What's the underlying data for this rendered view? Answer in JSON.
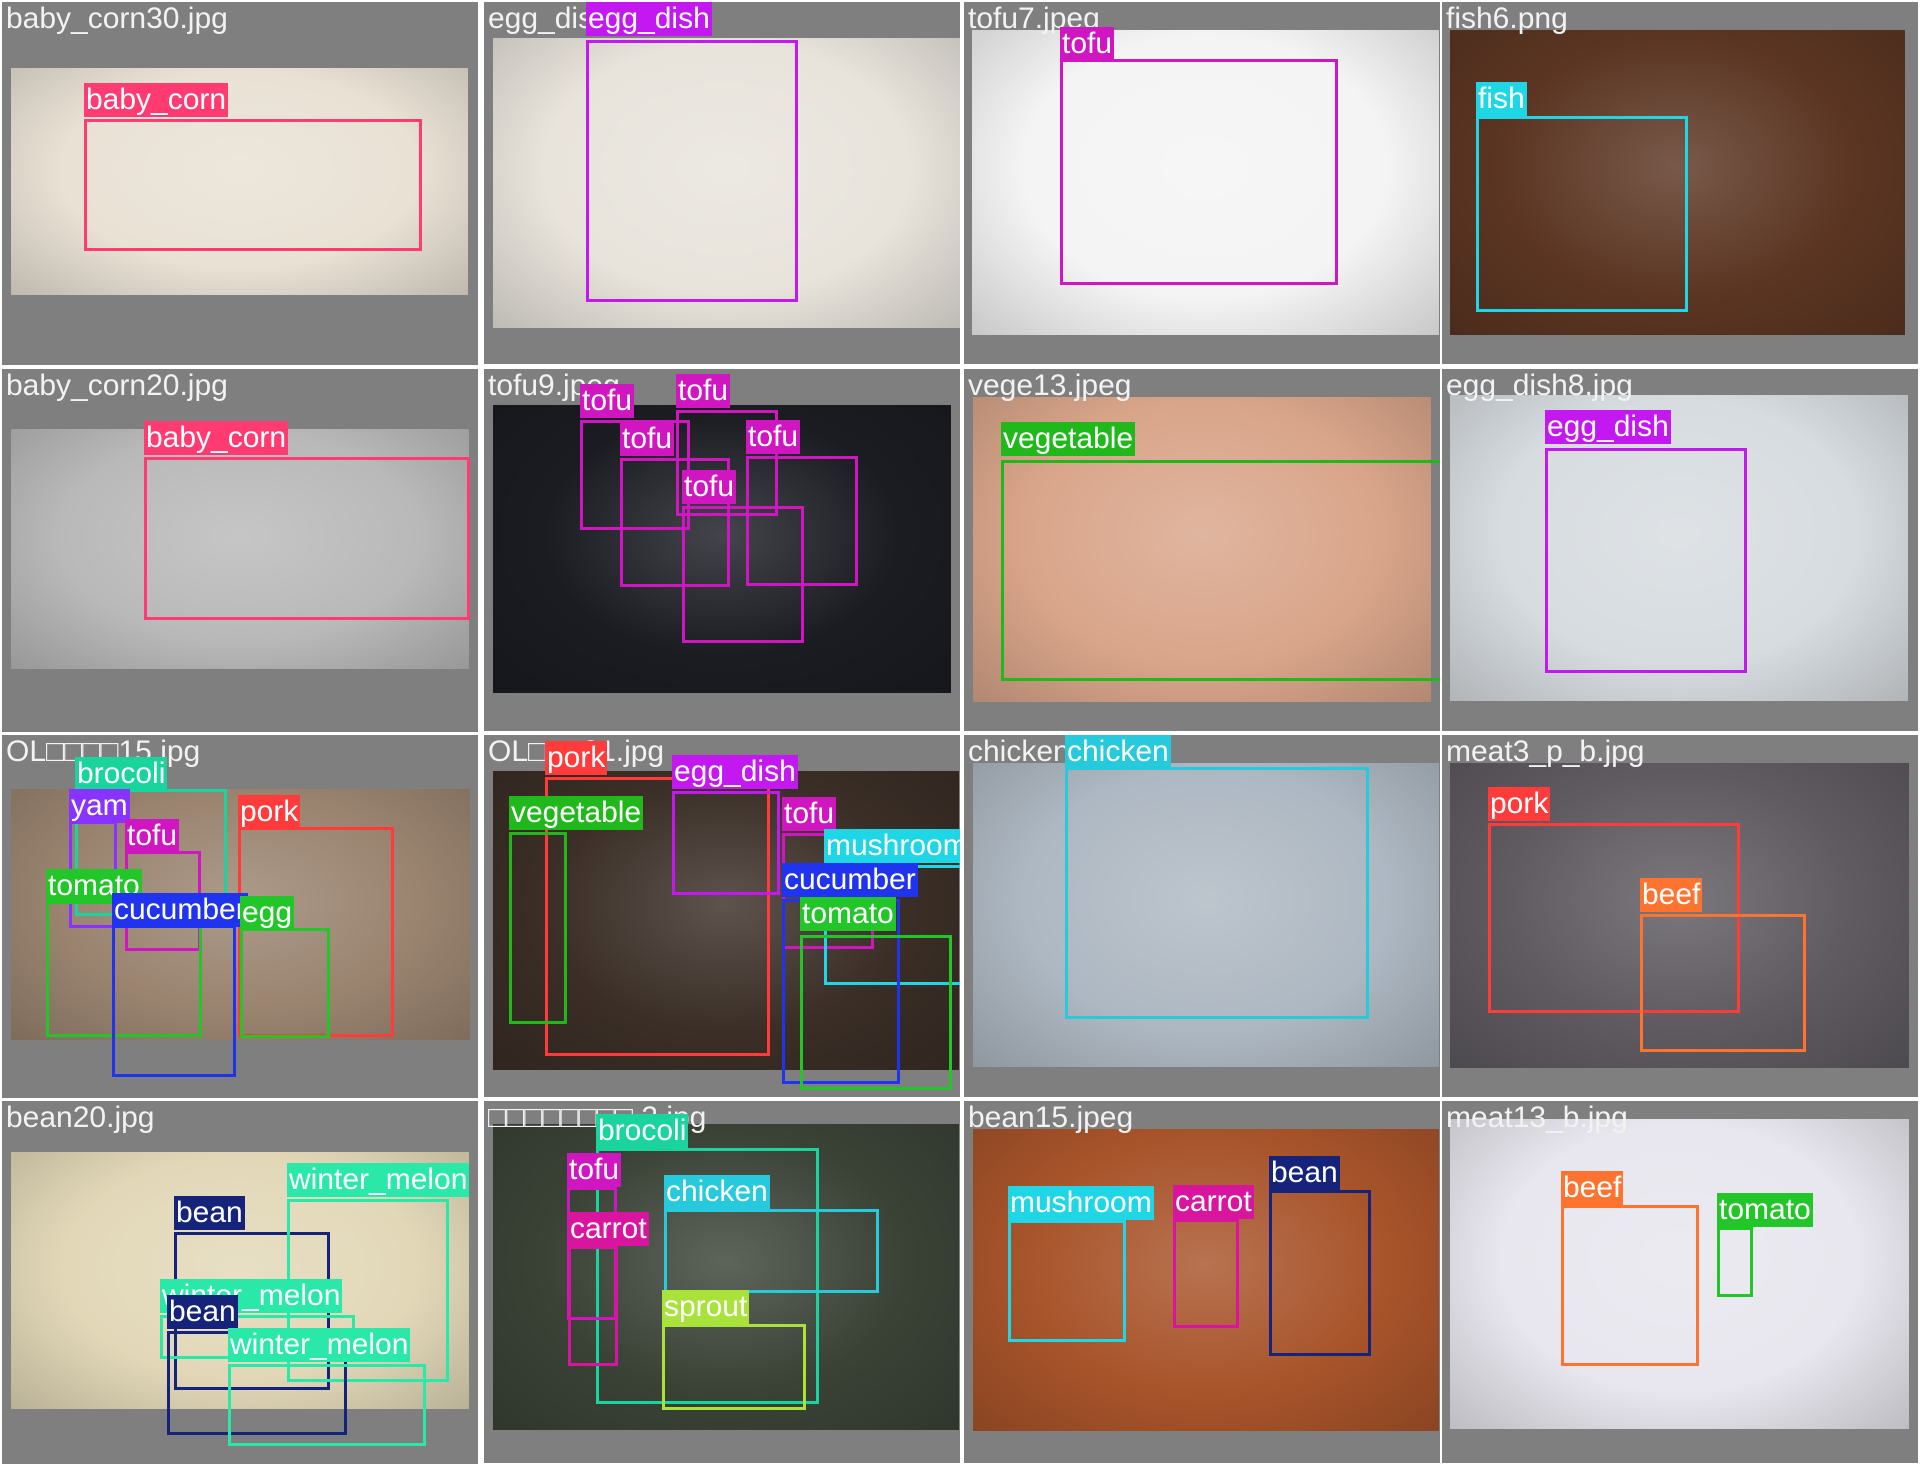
{
  "classes": {
    "baby_corn": "#ff3b72",
    "egg_dish": "#c318ef",
    "tofu": "#cf16c0",
    "fish": "#1fd6e6",
    "vegetable": "#21b81c",
    "pork": "#ff3b3b",
    "chicken": "#27c9dc",
    "beef": "#ff7330",
    "brocoli": "#19d49c",
    "yam": "#8833ff",
    "tomato": "#22c628",
    "cucumber": "#2033ee",
    "egg": "#22c628",
    "mushroom": "#1fd6e6",
    "bean": "#16237a",
    "winter_melon": "#2ae8a8",
    "carrot": "#d9149f",
    "sprout": "#a8e23a"
  },
  "tiles": [
    {
      "filename": "baby_corn30.jpg",
      "photo_color": "#e9e1d4",
      "detections": [
        {
          "label": "baby_corn"
        }
      ]
    },
    {
      "filename": "egg_dish",
      "photo_color": "#e8e4dc",
      "detections": [
        {
          "label": "egg_dish"
        }
      ]
    },
    {
      "filename": "tofu7.jpeg",
      "photo_color": "#f4f4f4",
      "detections": [
        {
          "label": "tofu"
        }
      ]
    },
    {
      "filename": "fish6.png",
      "photo_color": "#5b3522",
      "detections": [
        {
          "label": "fish"
        }
      ]
    },
    {
      "filename": "baby_corn20.jpg",
      "photo_color": "#b9b9b9",
      "detections": [
        {
          "label": "baby_corn"
        }
      ]
    },
    {
      "filename": "tofu9.jpeg",
      "photo_color": "#1a1c22",
      "detections": [
        {
          "label": "tofu"
        },
        {
          "label": "tofu"
        },
        {
          "label": "tofu"
        },
        {
          "label": "tofu"
        },
        {
          "label": "tofu"
        }
      ]
    },
    {
      "filename": "vege13.jpeg",
      "photo_color": "#d9a58a",
      "detections": [
        {
          "label": "vegetable"
        }
      ]
    },
    {
      "filename": "egg_dish8.jpg",
      "photo_color": "#d7dce0",
      "detections": [
        {
          "label": "egg_dish"
        }
      ]
    },
    {
      "filename": "OL□□□□15.jpg",
      "photo_color": "#9a8470",
      "detections": [
        {
          "label": "brocoli"
        },
        {
          "label": "yam"
        },
        {
          "label": "tofu"
        },
        {
          "label": "pork"
        },
        {
          "label": "tomato"
        },
        {
          "label": "cucumber"
        },
        {
          "label": "egg"
        }
      ]
    },
    {
      "filename": "OL□□□01.jpg",
      "photo_color": "#3a2e26",
      "detections": [
        {
          "label": "pork"
        },
        {
          "label": "egg_dish"
        },
        {
          "label": "vegetable"
        },
        {
          "label": "tofu"
        },
        {
          "label": "mushroom"
        },
        {
          "label": "cucumber"
        },
        {
          "label": "tomato"
        }
      ]
    },
    {
      "filename": "chicken",
      "photo_color": "#aeb8c2",
      "detections": [
        {
          "label": "chicken"
        }
      ]
    },
    {
      "filename": "meat3_p_b.jpg",
      "photo_color": "#5e5a60",
      "detections": [
        {
          "label": "pork"
        },
        {
          "label": "beef"
        }
      ]
    },
    {
      "filename": "bean20.jpg",
      "photo_color": "#e2d8b8",
      "detections": [
        {
          "label": "bean"
        },
        {
          "label": "winter_melon"
        },
        {
          "label": "winter_melon"
        },
        {
          "label": "bean"
        },
        {
          "label": "winter_melon"
        }
      ]
    },
    {
      "filename": "□□□□□□□□ 2.jpg",
      "photo_color": "#3a4236",
      "detections": [
        {
          "label": "brocoli"
        },
        {
          "label": "tofu"
        },
        {
          "label": "chicken"
        },
        {
          "label": "carrot"
        },
        {
          "label": "sprout"
        }
      ]
    },
    {
      "filename": "bean15.jpeg",
      "photo_color": "#a8542a",
      "detections": [
        {
          "label": "bean"
        },
        {
          "label": "mushroom"
        },
        {
          "label": "carrot"
        }
      ]
    },
    {
      "filename": "meat13_b.jpg",
      "photo_color": "#e8e6ee",
      "detections": [
        {
          "label": "beef"
        },
        {
          "label": "tomato"
        }
      ]
    }
  ]
}
